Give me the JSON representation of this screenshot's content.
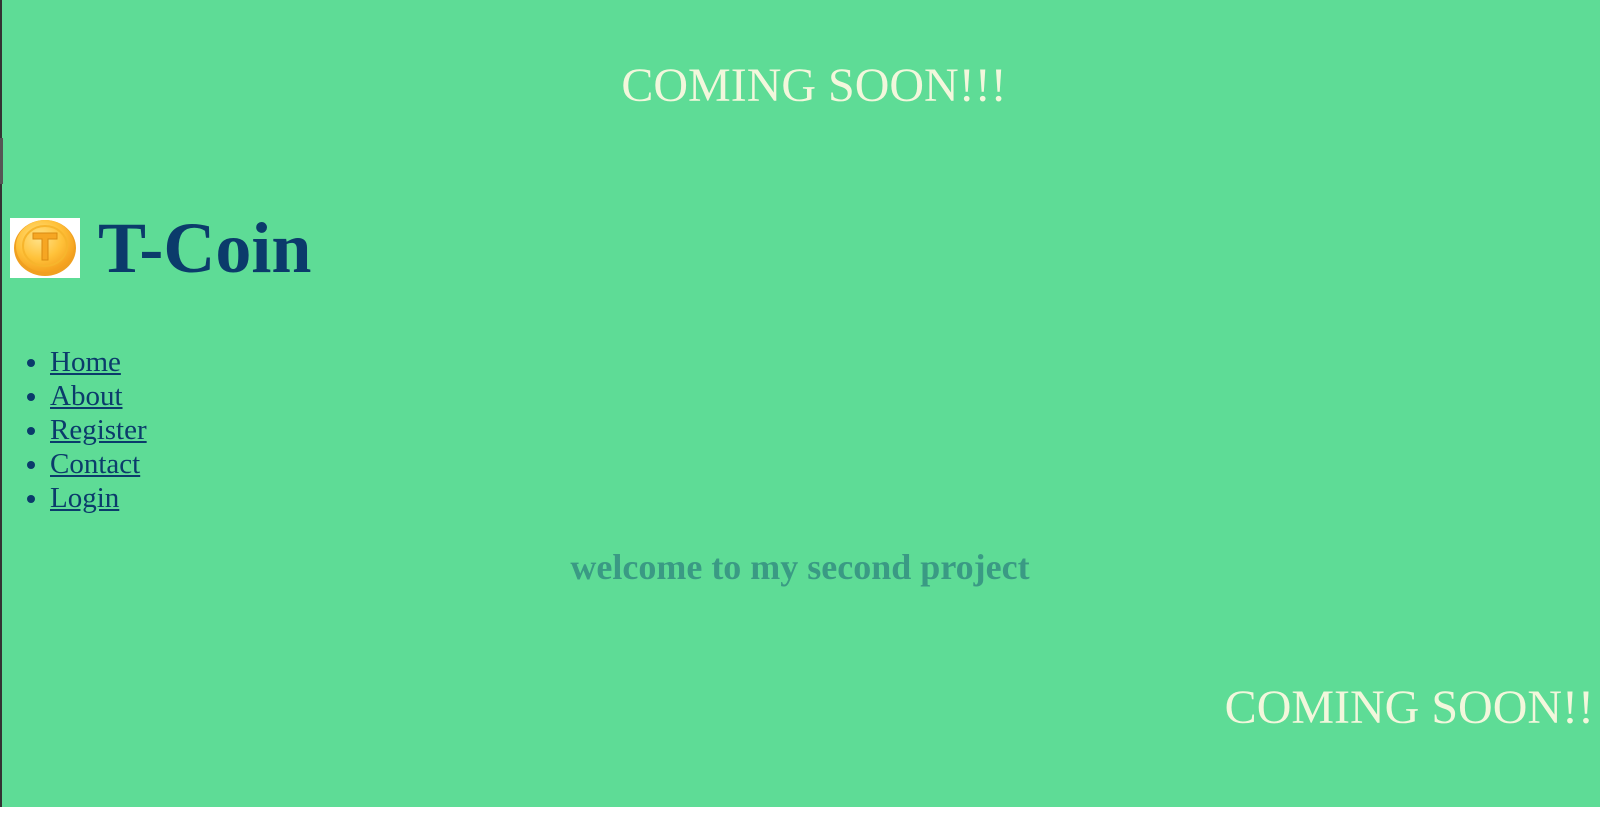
{
  "page": {
    "background_color": "#5edc96",
    "text_accent": "#f2f7dc",
    "brand_color": "#0b3b6b",
    "welcome_color": "#3a9a84"
  },
  "marquee": {
    "top_text": "COMING SOON!!!",
    "bottom_text": "COMING SOON!!"
  },
  "brand": {
    "logo_icon": "t-coin-logo",
    "title": "T-Coin"
  },
  "nav": {
    "items": [
      {
        "label": "Home"
      },
      {
        "label": "About"
      },
      {
        "label": "Register"
      },
      {
        "label": "Contact"
      },
      {
        "label": "Login"
      }
    ]
  },
  "main": {
    "welcome": "welcome to my second project"
  }
}
